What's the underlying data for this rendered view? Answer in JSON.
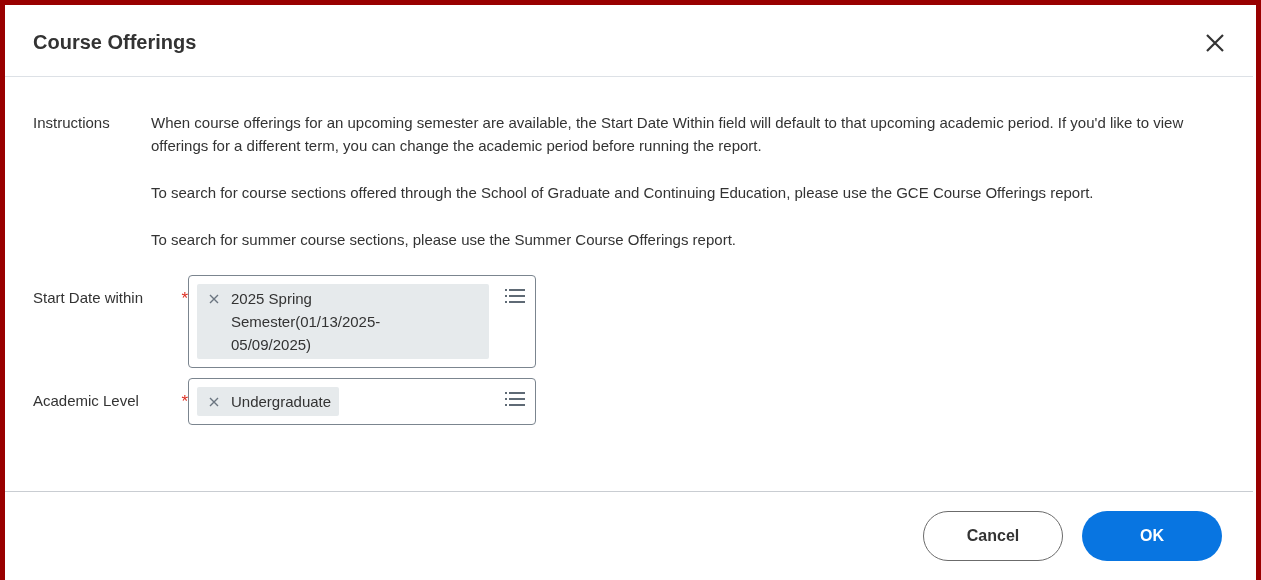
{
  "dialog": {
    "title": "Course Offerings"
  },
  "instructions": {
    "label": "Instructions",
    "paragraphs": [
      "When course offerings for an upcoming semester are available, the Start Date Within field will default to that upcoming academic period. If you'd like to view offerings for a different term, you can change the academic period before running the report.",
      "To search for course sections offered through the School of Graduate and Continuing Education, please use the GCE Course Offerings report.",
      "To search for summer course sections, please use the Summer Course Offerings report."
    ]
  },
  "fields": [
    {
      "label": "Start Date within",
      "required_mark": "*",
      "chips": [
        "2025 Spring Semester(01/13/2025-05/09/2025)"
      ]
    },
    {
      "label": "Academic Level",
      "required_mark": "*",
      "chips": [
        "Undergraduate"
      ]
    }
  ],
  "buttons": [
    {
      "label": "Cancel",
      "kind": "secondary"
    },
    {
      "label": "OK",
      "kind": "primary"
    }
  ]
}
